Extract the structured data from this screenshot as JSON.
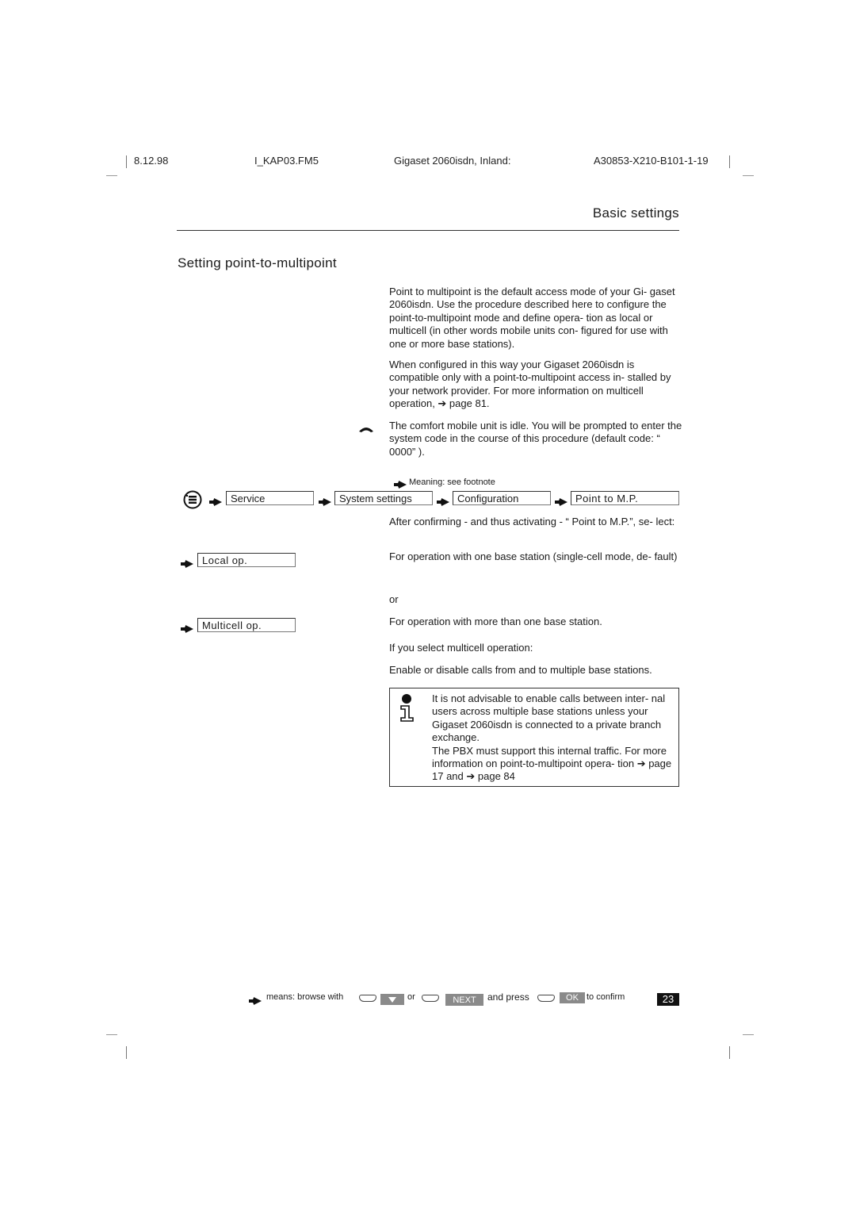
{
  "header": {
    "date": "8.12.98",
    "file": "I_KAP03.FM5",
    "product": "Gigaset 2060isdn, Inland:",
    "doc_number": "A30853-X210-B101-1-19"
  },
  "chapter_title": "Basic settings",
  "section_title": "Setting point-to-multipoint",
  "intro_paragraphs": [
    "Point to multipoint is the default access mode of your Gi- gaset 2060isdn. Use the procedure described here to configure the point-to-multipoint mode and define opera- tion as local or multicell (in other words mobile units con- figured for use with one or more base stations).",
    "When configured in this way your Gigaset 2060isdn is compatible only with a point-to-multipoint access in- stalled by your network provider. For more information on multicell operation, ➔ page 81."
  ],
  "idle_note": "The comfort mobile unit is idle. You will be prompted to enter the system code in the course of this procedure (default code: “ 0000” ).",
  "footnote_hint": "Meaning: see footnote",
  "menu_path": [
    {
      "icon": "menu-key-icon"
    },
    {
      "label": "Service"
    },
    {
      "label": "System settings"
    },
    {
      "label": "Configuration"
    },
    {
      "label": "Point to M.P."
    }
  ],
  "after_confirm": "After confirming - and thus activating - “ Point to M.P.”, se- lect:",
  "options": [
    {
      "label": "Local op.",
      "description": "For operation with one base station (single-cell mode, de- fault)"
    },
    {
      "label": "Multicell op.",
      "description": "For operation with more than one base station."
    }
  ],
  "or_text": "or",
  "multicell_intro": "If you select multicell operation:",
  "multicell_desc": "Enable or disable calls from and to multiple base stations.",
  "info_note": {
    "line1": "It is not advisable to enable calls between inter- nal users across multiple base stations unless your Gigaset 2060isdn is connected to a private branch exchange.",
    "line2": "The PBX must support this internal traffic. For more information on point-to-multipoint opera- tion ➔ page 17 and ➔ page 84"
  },
  "footer": {
    "means": "means: browse with",
    "or": "or",
    "next_key": "NEXT",
    "and_press": "and press",
    "ok_key": "OK",
    "to_confirm": "to confirm",
    "page_number": "23"
  }
}
